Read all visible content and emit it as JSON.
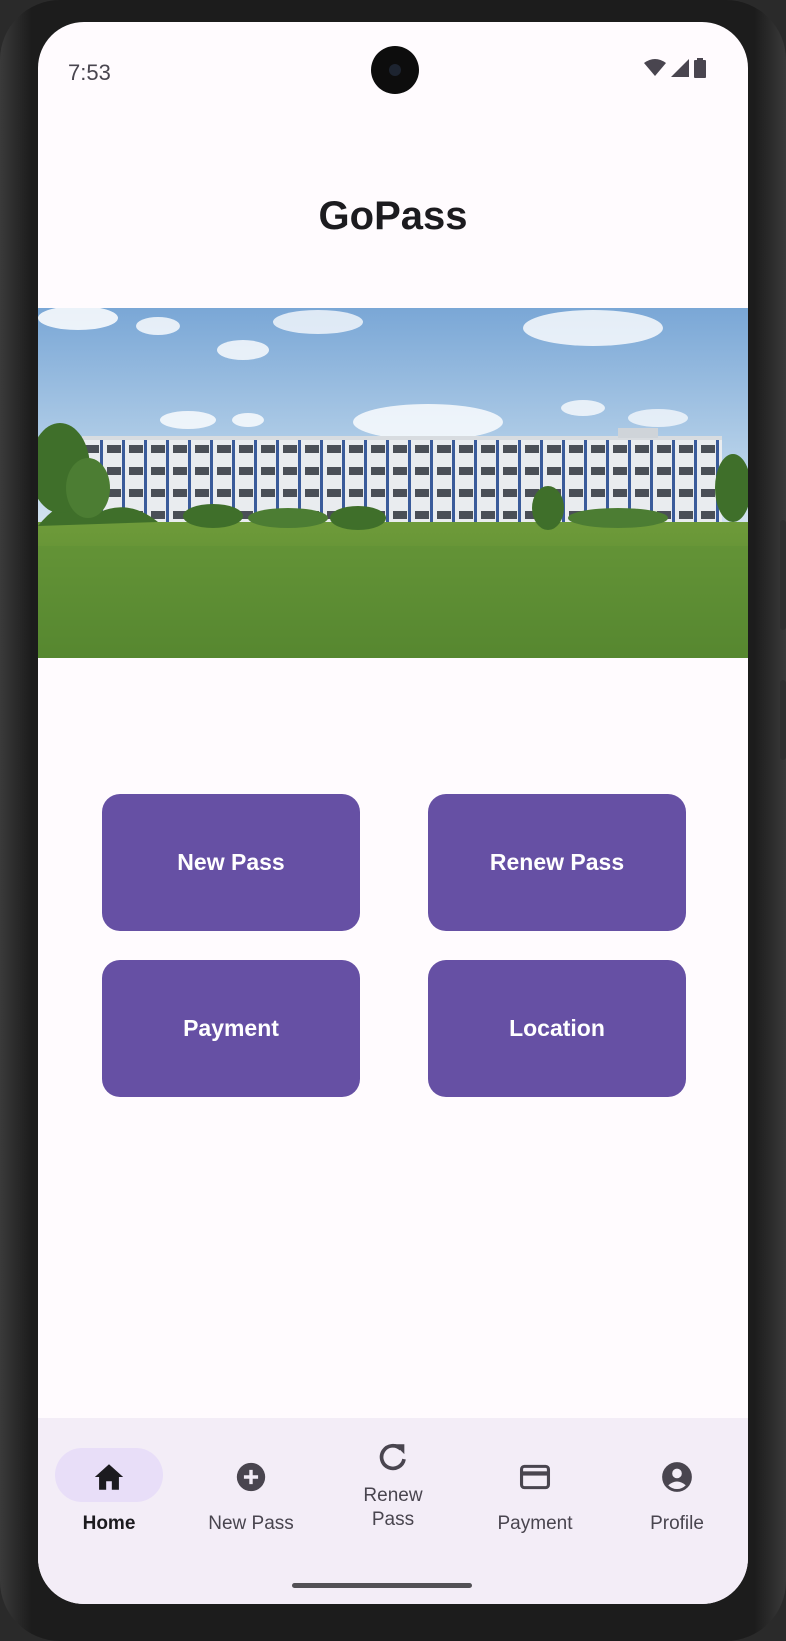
{
  "status_bar": {
    "time": "7:53",
    "icons": [
      "wifi-icon",
      "signal-icon",
      "battery-icon"
    ]
  },
  "app": {
    "title": "GoPass"
  },
  "banner": {
    "image": "college-building-photo"
  },
  "actions": [
    {
      "label": "New Pass"
    },
    {
      "label": "Renew Pass"
    },
    {
      "label": "Payment"
    },
    {
      "label": "Location"
    }
  ],
  "bottom_nav": {
    "items": [
      {
        "label": "Home",
        "icon": "home-icon",
        "active": true
      },
      {
        "label": "New Pass",
        "icon": "add-circle-icon",
        "active": false
      },
      {
        "label": "Renew\nPass",
        "icon": "refresh-icon",
        "active": false
      },
      {
        "label": "Payment",
        "icon": "credit-card-icon",
        "active": false
      },
      {
        "label": "Profile",
        "icon": "account-circle-icon",
        "active": false
      }
    ]
  },
  "colors": {
    "primary": "#6650a4",
    "nav_background": "#f3edf7",
    "nav_active_indicator": "#e8def8",
    "screen_background": "#fffbfe"
  }
}
